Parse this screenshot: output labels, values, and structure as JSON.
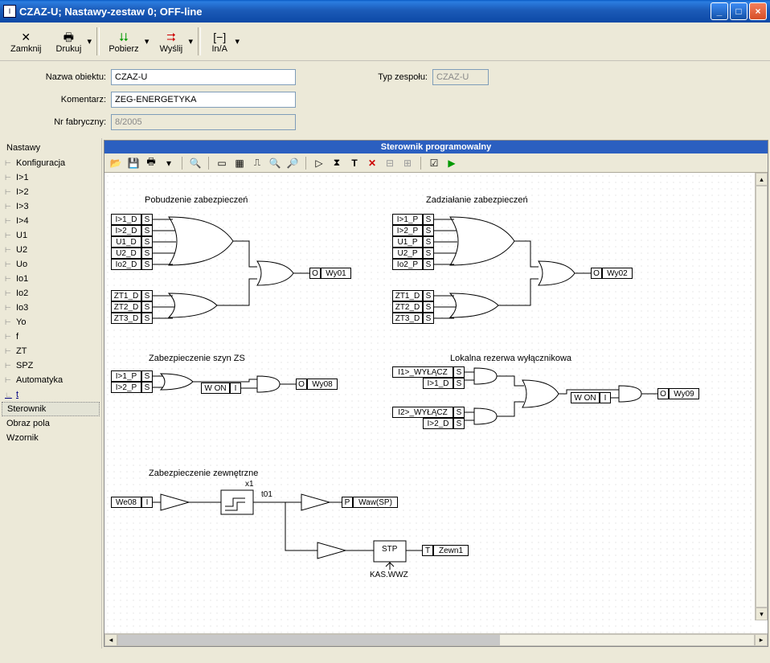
{
  "window": {
    "title": "CZAZ-U; Nastawy-zestaw 0; OFF-line",
    "icon_text": "I"
  },
  "toolbar": {
    "close": "Zamknij",
    "print": "Drukuj",
    "download": "Pobierz",
    "send": "Wyślij",
    "ina": "In/A"
  },
  "form": {
    "object_label": "Nazwa obiektu:",
    "object_value": "CZAZ-U",
    "comment_label": "Komentarz:",
    "comment_value": "ZEG-ENERGETYKA",
    "factory_label": "Nr fabryczny:",
    "factory_value": "8/2005",
    "type_label": "Typ zespołu:",
    "type_value": "CZAZ-U"
  },
  "sidebar": {
    "header": "Nastawy",
    "items": [
      "Konfiguracja",
      "I>1",
      "I>2",
      "I>3",
      "I>4",
      "U1",
      "U2",
      "Uo",
      "Io1",
      "Io2",
      "Io3",
      "Yo",
      "f",
      "ZT",
      "SPZ",
      "Automatyka",
      "t"
    ],
    "sterownik": "Sterownik",
    "obraz": "Obraz pola",
    "wzornik": "Wzornik"
  },
  "canvas": {
    "title": "Sterownik programowalny",
    "sections": {
      "s1": "Pobudzenie zabezpieczeń",
      "s2": "Zadziałanie zabezpieczeń",
      "s3": "Zabezpieczenie szyn ZS",
      "s4": "Lokalna rezerwa wyłącznikowa",
      "s5": "Zabezpieczenie zewnętrzne"
    },
    "signals": {
      "g1": [
        "I>1_D",
        "I>2_D",
        "U1_D",
        "U2_D",
        "Io2_D",
        "ZT1_D",
        "ZT2_D",
        "ZT3_D"
      ],
      "g2": [
        "I>1_P",
        "I>2_P",
        "U1_P",
        "U2_P",
        "Io2_P",
        "ZT1_D",
        "ZT2_D",
        "ZT3_D"
      ],
      "g3": [
        "I>1_P",
        "I>2_P"
      ],
      "g4": [
        "I1>_WYŁĄCZ",
        "I>1_D",
        "I2>_WYŁĄCZ",
        "I>2_D"
      ]
    },
    "outputs": {
      "o1": "Wy01",
      "o2": "Wy02",
      "o3": "Wy08",
      "o4": "Wy09",
      "won": "W ON",
      "waw": "Waw(SP)",
      "zewn": "Zewn1",
      "we08": "We08",
      "stp": "STP",
      "kas": "KAS.WWZ",
      "x1": "x1",
      "t01": "t01"
    },
    "flags": {
      "S": "S",
      "I": "I",
      "O": "O",
      "P": "P",
      "T": "T"
    }
  }
}
